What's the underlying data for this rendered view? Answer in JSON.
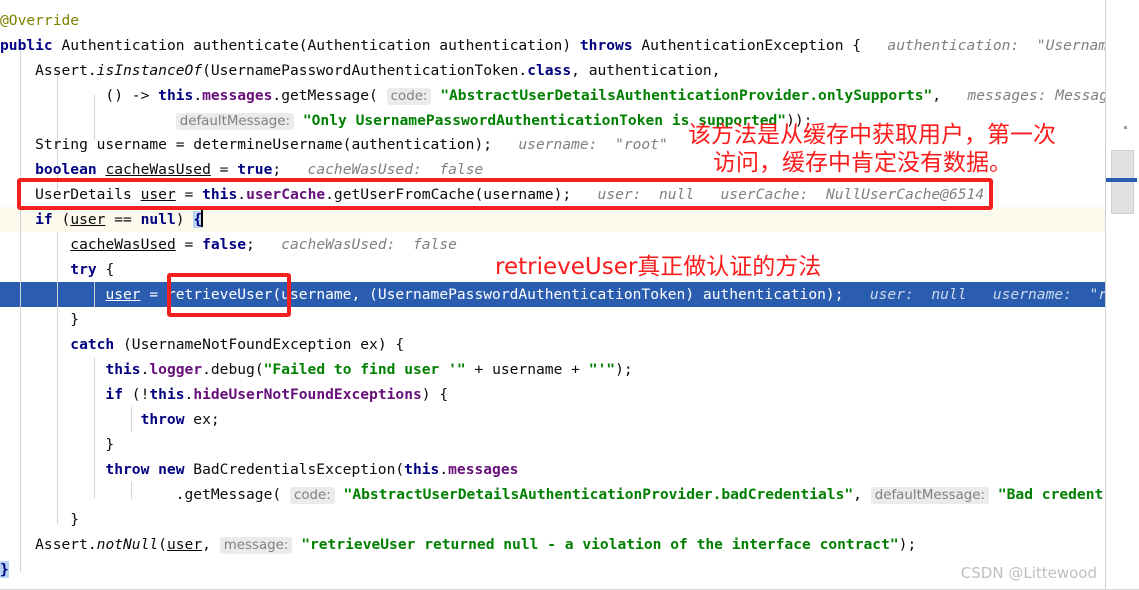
{
  "app": {
    "kind": "java-code-editor",
    "watermark": "CSDN @Littewood"
  },
  "code": {
    "language": "Java",
    "lines": [
      {
        "n": 1,
        "indent": 0,
        "text": "@Override"
      },
      {
        "n": 2,
        "indent": 0,
        "text": "public Authentication authenticate(Authentication authentication) throws AuthenticationException {"
      },
      {
        "n": 3,
        "indent": 1,
        "text": "Assert.isInstanceOf(UsernamePasswordAuthenticationToken.class, authentication,"
      },
      {
        "n": 4,
        "indent": 3,
        "text": "() -> this.messages.getMessage( code: \"AbstractUserDetailsAuthenticationProvider.onlySupports\","
      },
      {
        "n": 5,
        "indent": 5,
        "text": "defaultMessage: \"Only UsernamePasswordAuthenticationToken is supported\"));"
      },
      {
        "n": 6,
        "indent": 1,
        "text": "String username = determineUsername(authentication);"
      },
      {
        "n": 7,
        "indent": 1,
        "text": "boolean cacheWasUsed = true;"
      },
      {
        "n": 8,
        "indent": 1,
        "text": "UserDetails user = this.userCache.getUserFromCache(username);"
      },
      {
        "n": 9,
        "indent": 1,
        "text": "if (user == null) {"
      },
      {
        "n": 10,
        "indent": 2,
        "text": "cacheWasUsed = false;"
      },
      {
        "n": 11,
        "indent": 2,
        "text": "try {"
      },
      {
        "n": 12,
        "indent": 3,
        "text": "user = retrieveUser(username, (UsernamePasswordAuthenticationToken) authentication);"
      },
      {
        "n": 13,
        "indent": 2,
        "text": "}"
      },
      {
        "n": 14,
        "indent": 2,
        "text": "catch (UsernameNotFoundException ex) {"
      },
      {
        "n": 15,
        "indent": 3,
        "text": "this.logger.debug(\"Failed to find user '\" + username + \"'\");"
      },
      {
        "n": 16,
        "indent": 3,
        "text": "if (!this.hideUserNotFoundExceptions) {"
      },
      {
        "n": 17,
        "indent": 4,
        "text": "throw ex;"
      },
      {
        "n": 18,
        "indent": 3,
        "text": "}"
      },
      {
        "n": 19,
        "indent": 3,
        "text": "throw new BadCredentialsException(this.messages"
      },
      {
        "n": 20,
        "indent": 5,
        "text": ".getMessage( code: \"AbstractUserDetailsAuthenticationProvider.badCredentials\", defaultMessage: \"Bad credent"
      },
      {
        "n": 21,
        "indent": 2,
        "text": "}"
      },
      {
        "n": 22,
        "indent": 2,
        "text": "Assert.notNull(user,  message: \"retrieveUser returned null - a violation of the interface contract\");"
      },
      {
        "n": 23,
        "indent": 0,
        "text": "}"
      }
    ],
    "inline_hints": [
      {
        "label": "code:",
        "line": 4
      },
      {
        "label": "defaultMessage:",
        "line": 5
      },
      {
        "label": "code:",
        "line": 20
      },
      {
        "label": "defaultMessage:",
        "line": 20
      },
      {
        "label": "message:",
        "line": 22
      }
    ],
    "debug_values": [
      {
        "line": 2,
        "text": "authentication:  \"UsernameP"
      },
      {
        "line": 4,
        "text": "messages: Message"
      },
      {
        "line": 6,
        "text": "username:  \"root\""
      },
      {
        "line": 7,
        "text": "cacheWasUsed:  false"
      },
      {
        "line": 8,
        "text": "user:  null    userCache:  NullUserCache@6514"
      },
      {
        "line": 10,
        "text": "cacheWasUsed:  false"
      },
      {
        "line": 12,
        "text": "user:  null    username:  \"root\""
      }
    ]
  },
  "annotations": {
    "note1_line1": "该方法是从缓存中获取用户，第一次",
    "note1_line2": "访问，缓存中肯定没有数据。",
    "note2": "retrieveUser真正做认证的方法",
    "box1_target": "UserDetails user = this.userCache.getUserFromCache(username);",
    "box2_target": "retrieveUser("
  },
  "editor_state": {
    "current_line_text": "if (user == null) {",
    "selected_line_text": "user = retrieveUser(username, (UsernamePasswordAuthenticationToken) authentication);",
    "caret_after": "{",
    "brace_match_top": "{",
    "brace_match_bottom": "}"
  },
  "colors": {
    "keyword": "#000080",
    "string": "#008000",
    "field": "#660e7a",
    "annotation_text": "#808000",
    "hint_gray": "#808080",
    "selection_bg": "#2a5db0",
    "current_line_bg": "#fcfaed",
    "red_marker": "#fc1b1b",
    "brace_highlight": "#b8d4f5"
  },
  "scrollbar": {
    "orientation": "vertical",
    "marker_color": "#2a5db0"
  }
}
